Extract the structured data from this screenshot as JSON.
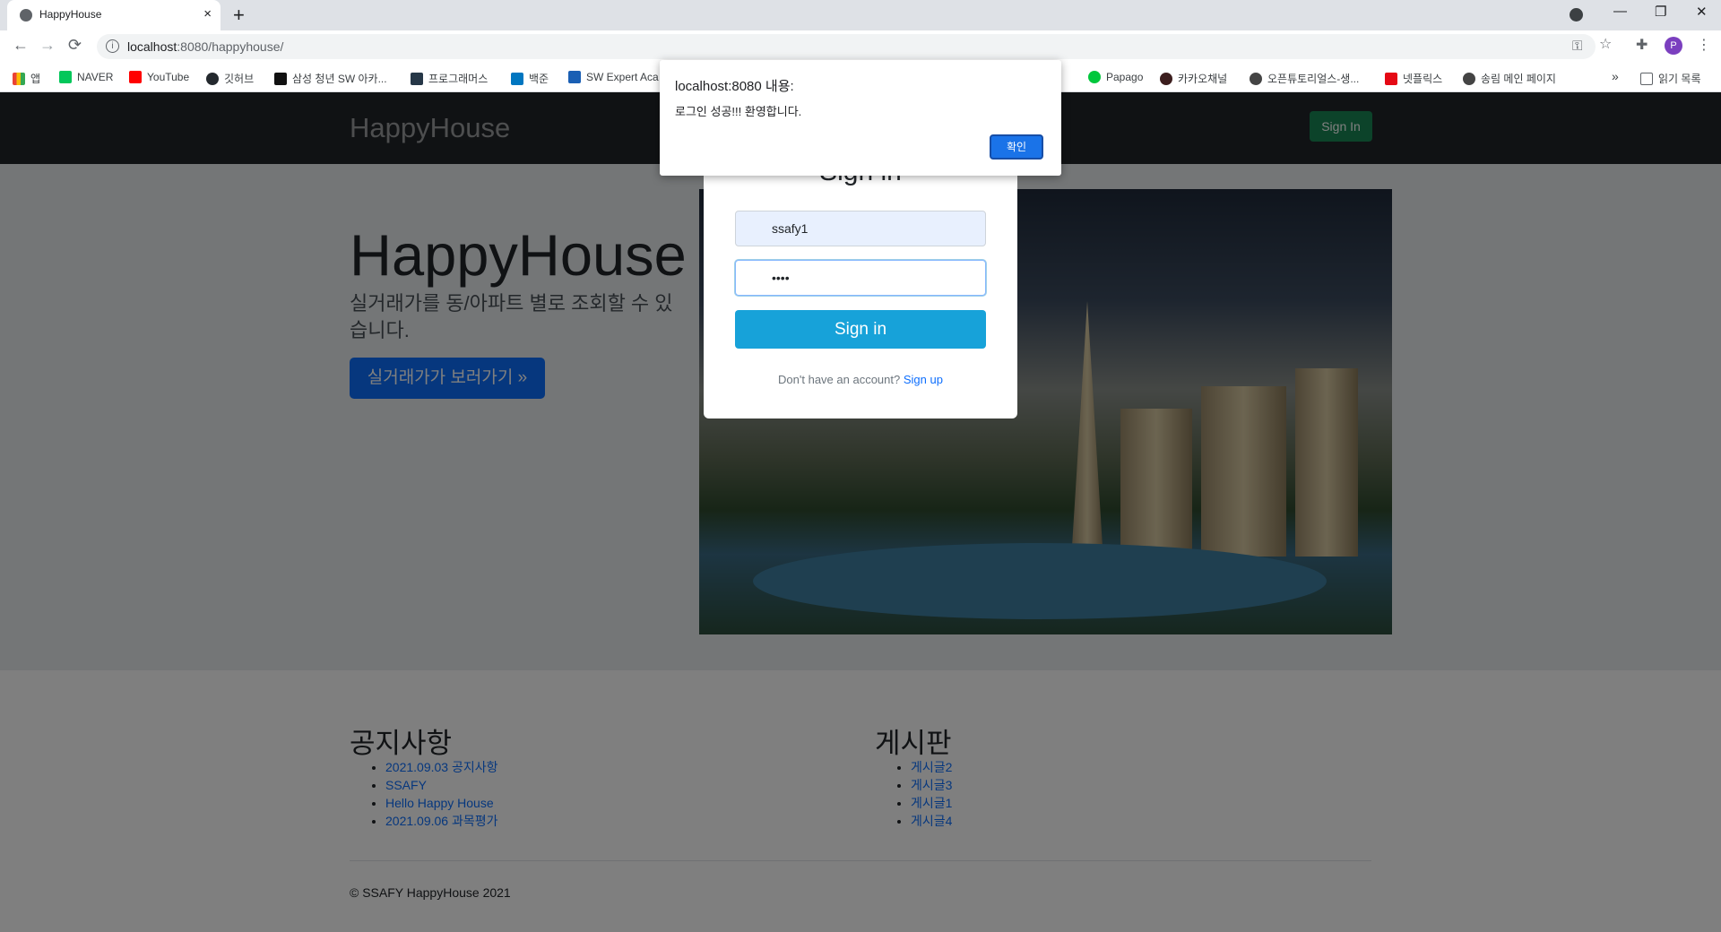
{
  "browser": {
    "tab_title": "HappyHouse",
    "tab_close": "×",
    "new_tab": "+",
    "url_host": "localhost",
    "url_path": ":8080/happyhouse/",
    "bookmarks": [
      {
        "label": "앱",
        "color": "#e53935"
      },
      {
        "label": "NAVER",
        "color": "#03c75a"
      },
      {
        "label": "YouTube",
        "color": "#ff0000"
      },
      {
        "label": "깃허브",
        "color": "#24292e"
      },
      {
        "label": "삼성 청년 SW 아카...",
        "color": "#111111"
      },
      {
        "label": "프로그래머스",
        "color": "#263747"
      },
      {
        "label": "백준",
        "color": "#0076c0"
      },
      {
        "label": "SW Expert Aca",
        "color": "#1a5fb4"
      },
      {
        "label": "Papago",
        "color": "#00c73c"
      },
      {
        "label": "카카오채널",
        "color": "#3c1e1e"
      },
      {
        "label": "오픈튜토리얼스-생...",
        "color": "#444444"
      },
      {
        "label": "넷플릭스",
        "color": "#e50914"
      },
      {
        "label": "송림 메인 페이지",
        "color": "#444444"
      }
    ],
    "bookmarks_more": "»",
    "reading_list": "읽기 목록",
    "avatar_letter": "P"
  },
  "navbar": {
    "brand": "HappyHouse",
    "signin_label": "Sign In"
  },
  "hero": {
    "title": "HappyHouse",
    "subtitle": "실거래가를 동/아파트 별로 조회할 수 있습니다.",
    "button_label": "실거래가가 보러가기 »"
  },
  "notices": {
    "title": "공지사항",
    "items": [
      "2021.09.03 공지사항",
      "SSAFY",
      "Hello Happy House",
      "2021.09.06 과목평가"
    ]
  },
  "board": {
    "title": "게시판",
    "items": [
      "게시글2",
      "게시글3",
      "게시글1",
      "게시글4"
    ]
  },
  "footer": {
    "copyright": "© SSAFY HappyHouse 2021"
  },
  "modal": {
    "title": "Sign in",
    "username_value": "ssafy1",
    "password_value": "••••",
    "submit_label": "Sign in",
    "footer_text": "Don't have an account?",
    "signup_link": "Sign up"
  },
  "alert": {
    "title": "localhost:8080 내용:",
    "message": "로그인 성공!!! 환영합니다.",
    "ok_label": "확인"
  }
}
